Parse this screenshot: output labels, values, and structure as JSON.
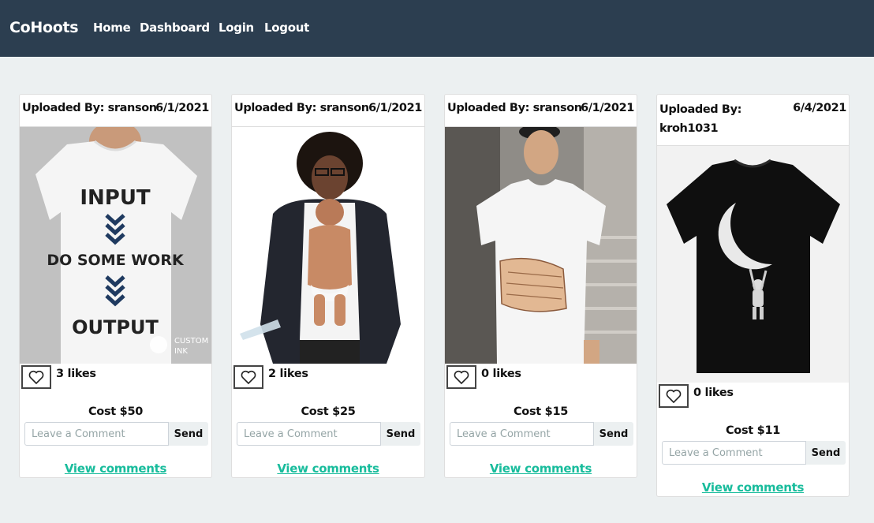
{
  "nav": {
    "brand": "CoHoots",
    "links": [
      "Home",
      "Dashboard",
      "Login",
      "Logout"
    ]
  },
  "uploaded_by_label": "Uploaded By:",
  "comment_placeholder": "Leave a Comment",
  "send_label": "Send",
  "view_comments_label": "View comments",
  "posts": [
    {
      "user": "sranson",
      "date": "6/1/2021",
      "likes": "3 likes",
      "cost": "Cost $50",
      "image": "white t-shirt printed INPUT, DO SOME WORK, OUTPUT"
    },
    {
      "user": "sranson",
      "date": "6/1/2021",
      "likes": "2 likes",
      "cost": "Cost $25",
      "image": "man in hoodie wearing baby-body print t-shirt"
    },
    {
      "user": "sranson",
      "date": "6/1/2021",
      "likes": "0 likes",
      "cost": "Cost $15",
      "image": "man wearing t-shirt with giant hand grabbing print"
    },
    {
      "user": "kroh1031",
      "date": "6/4/2021",
      "likes": "0 likes",
      "cost": "Cost $11",
      "image": "black t-shirt with astronaut holding crescent moon"
    }
  ],
  "colors": {
    "navbar": "#2c3e50",
    "background": "#ecf0f1",
    "link": "#18bc9c"
  }
}
